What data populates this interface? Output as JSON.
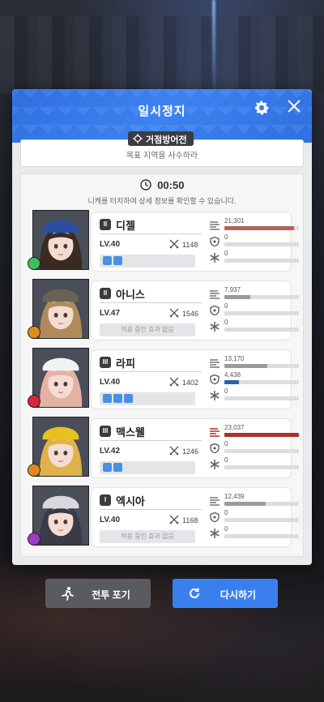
{
  "pause": {
    "title": "일시정지",
    "icons": {
      "settings": "gear-icon",
      "close": "close-icon"
    },
    "mission": {
      "tag": "거점방어전",
      "description": "목표 지역을 사수하라"
    },
    "timer": "00:50",
    "hint": "니케를 터치하여 상세 정보를 확인할 수 있습니다.",
    "units": [
      {
        "burst": "II",
        "name": "디젤",
        "level": "LV.40",
        "power": "1148",
        "element_color": "#3fbe5b",
        "effects": "",
        "buffs": 2,
        "stats": [
          {
            "icon": "damage-icon",
            "value": "21,301",
            "fill": 0.94,
            "color": "#b8605c"
          },
          {
            "icon": "shield-icon",
            "value": "0",
            "fill": 0,
            "color": "#3b6fb6"
          },
          {
            "icon": "heal-icon",
            "value": "0",
            "fill": 0,
            "color": "#999"
          }
        ]
      },
      {
        "burst": "II",
        "name": "아니스",
        "level": "LV.47",
        "power": "1546",
        "element_color": "#e08a1e",
        "effects": "적용 중인 효과 없음",
        "buffs": 0,
        "stats": [
          {
            "icon": "damage-icon",
            "value": "7,937",
            "fill": 0.35,
            "color": "#9a9a9c"
          },
          {
            "icon": "shield-icon",
            "value": "0",
            "fill": 0,
            "color": "#3b6fb6"
          },
          {
            "icon": "heal-icon",
            "value": "0",
            "fill": 0,
            "color": "#999"
          }
        ]
      },
      {
        "burst": "III",
        "name": "라피",
        "level": "LV.40",
        "power": "1402",
        "element_color": "#d7263d",
        "effects": "",
        "buffs": 3,
        "stats": [
          {
            "icon": "damage-icon",
            "value": "13,170",
            "fill": 0.58,
            "color": "#9a9a9c"
          },
          {
            "icon": "shield-icon",
            "value": "4,438",
            "fill": 0.2,
            "color": "#2f5fa8"
          },
          {
            "icon": "heal-icon",
            "value": "0",
            "fill": 0,
            "color": "#999"
          }
        ]
      },
      {
        "burst": "III",
        "name": "맥스웰",
        "level": "LV.42",
        "power": "1246",
        "element_color": "#e08a1e",
        "effects": "",
        "buffs": 2,
        "stats": [
          {
            "icon": "damage-icon",
            "value": "23,037",
            "fill": 1.0,
            "color": "#a8322b"
          },
          {
            "icon": "shield-icon",
            "value": "0",
            "fill": 0,
            "color": "#3b6fb6"
          },
          {
            "icon": "heal-icon",
            "value": "0",
            "fill": 0,
            "color": "#999"
          }
        ]
      },
      {
        "burst": "I",
        "name": "엑시아",
        "level": "LV.40",
        "power": "1168",
        "element_color": "#9b3cc4",
        "effects": "적용 중인 효과 없음",
        "buffs": 0,
        "stats": [
          {
            "icon": "damage-icon",
            "value": "12,439",
            "fill": 0.55,
            "color": "#9a9a9c"
          },
          {
            "icon": "shield-icon",
            "value": "0",
            "fill": 0,
            "color": "#3b6fb6"
          },
          {
            "icon": "heal-icon",
            "value": "0",
            "fill": 0,
            "color": "#999"
          }
        ]
      }
    ],
    "buttons": {
      "give_up": "전투 포기",
      "retry": "다시하기"
    },
    "colors": {
      "accent": "#3a7fee",
      "header": "#2f6fe0"
    }
  }
}
